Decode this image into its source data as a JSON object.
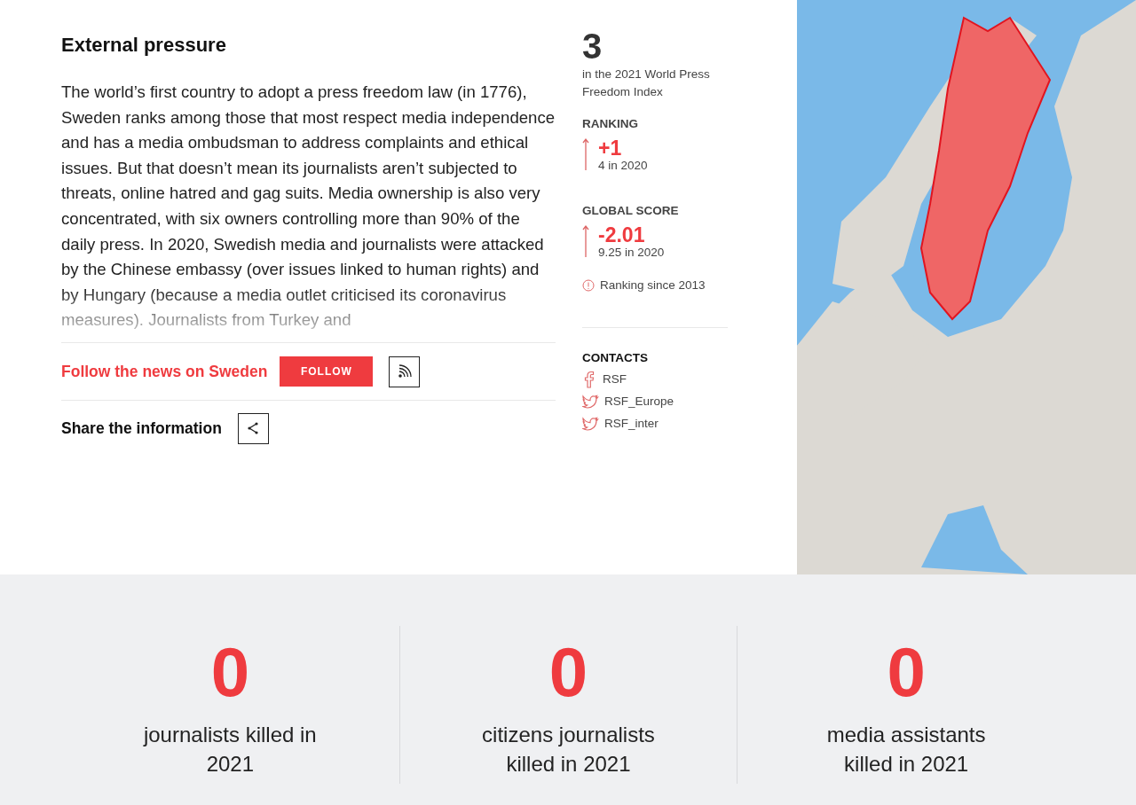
{
  "article": {
    "heading": "External pressure",
    "body": "The world’s first country to adopt a press freedom law (in 1776), Sweden ranks among those that most respect media independence and has a media ombudsman to address complaints and ethical issues. But that doesn’t mean its journalists aren’t subjected to threats, online hatred and gag suits. Media ownership is also very concentrated, with six owners controlling more than 90% of the daily press. In 2020, Swedish media and journalists were attacked by the Chinese embassy (over issues linked to human rights) and by Hungary (because a media outlet criticised its coronavirus measures). Journalists from Turkey and"
  },
  "follow": {
    "label": "Follow the news on Sweden",
    "button": "FOLLOW"
  },
  "share": {
    "label": "Share the information"
  },
  "index": {
    "rank": "3",
    "caption": "in the 2021 World Press Freedom Index",
    "metrics": [
      {
        "title": "RANKING",
        "rising": true,
        "change": "+1",
        "previous": "4 in 2020"
      },
      {
        "title": "GLOBAL SCORE",
        "rising": true,
        "change": "-2.01",
        "previous": "9.25 in 2020"
      }
    ],
    "note": "Ranking since 2013"
  },
  "contacts": {
    "title": "CONTACTS",
    "items": [
      {
        "kind": "facebook",
        "label": "RSF"
      },
      {
        "kind": "twitter",
        "label": "RSF_Europe"
      },
      {
        "kind": "twitter",
        "label": "RSF_inter"
      }
    ]
  },
  "stats": [
    {
      "value": "0",
      "label": "journalists killed in 2021"
    },
    {
      "value": "0",
      "label": "citizens journalists killed in 2021"
    },
    {
      "value": "0",
      "label": "media assistants killed in 2021"
    }
  ]
}
